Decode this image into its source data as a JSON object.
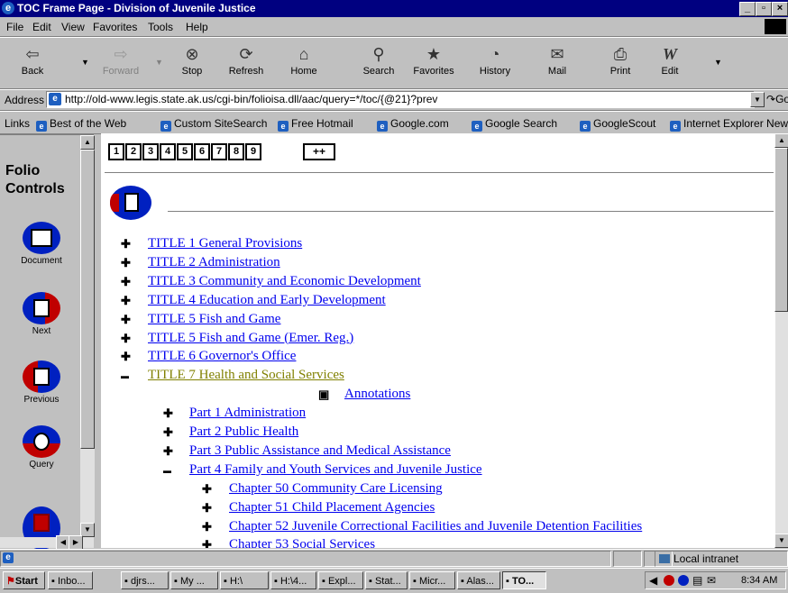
{
  "window": {
    "title": "TOC Frame Page - Division of Juvenile Justice"
  },
  "menu": [
    "File",
    "Edit",
    "View",
    "Favorites",
    "Tools",
    "Help"
  ],
  "toolbar": {
    "back": "Back",
    "forward": "Forward",
    "stop": "Stop",
    "refresh": "Refresh",
    "home": "Home",
    "search": "Search",
    "favorites": "Favorites",
    "history": "History",
    "mail": "Mail",
    "print": "Print",
    "edit": "Edit"
  },
  "address": {
    "label": "Address",
    "url": "http://old-www.legis.state.ak.us/cgi-bin/folioisa.dll/aac/query=*/toc/{@21}?prev",
    "go": "Go"
  },
  "links": {
    "label": "Links",
    "items": [
      "Best of the Web",
      "Custom SiteSearch",
      "Free Hotmail",
      "Google.com",
      "Google Search",
      "GoogleScout",
      "Internet Explorer News"
    ]
  },
  "folio": {
    "heading": [
      "Folio",
      "Controls"
    ],
    "controls": [
      "Document",
      "Next",
      "Previous",
      "Query"
    ]
  },
  "pages": [
    "1",
    "2",
    "3",
    "4",
    "5",
    "6",
    "7",
    "8",
    "9"
  ],
  "pages_more": "++",
  "toc": [
    {
      "label": "TITLE 1 General Provisions",
      "marker": "plus",
      "level": 0
    },
    {
      "label": "TITLE 2 Administration",
      "marker": "plus",
      "level": 0
    },
    {
      "label": "TITLE 3 Community and Economic Development",
      "marker": "plus",
      "level": 0
    },
    {
      "label": "TITLE 4 Education and Early Development",
      "marker": "plus",
      "level": 0
    },
    {
      "label": "TITLE 5 Fish and Game",
      "marker": "plus",
      "level": 0
    },
    {
      "label": "TITLE 5 Fish and Game (Emer. Reg.)",
      "marker": "plus",
      "level": 0
    },
    {
      "label": "TITLE 6 Governor's Office",
      "marker": "plus",
      "level": 0
    },
    {
      "label": "TITLE 7 Health and Social Services",
      "marker": "minus",
      "level": 0,
      "visited": true
    },
    {
      "label": "Annotations",
      "marker": "square",
      "level": 3
    },
    {
      "label": "Part 1 Administration",
      "marker": "plus",
      "level": 1
    },
    {
      "label": "Part 2 Public Health",
      "marker": "plus",
      "level": 1
    },
    {
      "label": "Part 3 Public Assistance and Medical Assistance",
      "marker": "plus",
      "level": 1
    },
    {
      "label": "Part 4 Family and Youth Services and Juvenile Justice",
      "marker": "minus",
      "level": 1
    },
    {
      "label": "Chapter 50 Community Care Licensing",
      "marker": "plus",
      "level": 2
    },
    {
      "label": "Chapter 51 Child Placement Agencies",
      "marker": "plus",
      "level": 2
    },
    {
      "label": "Chapter 52 Juvenile Correctional Facilities and Juvenile Detention Facilities",
      "marker": "plus",
      "level": 2
    },
    {
      "label": "Chapter 53 Social Services",
      "marker": "plus",
      "level": 2
    }
  ],
  "status": {
    "zone": "Local intranet"
  },
  "taskbar": {
    "start": "Start",
    "tasks": [
      "Inbo...",
      "djrs...",
      "My ...",
      "H:\\",
      "H:\\4...",
      "Expl...",
      "Stat...",
      "Micr...",
      "Alas...",
      "TO..."
    ],
    "active_index": 9,
    "clock": "8:34 AM"
  }
}
